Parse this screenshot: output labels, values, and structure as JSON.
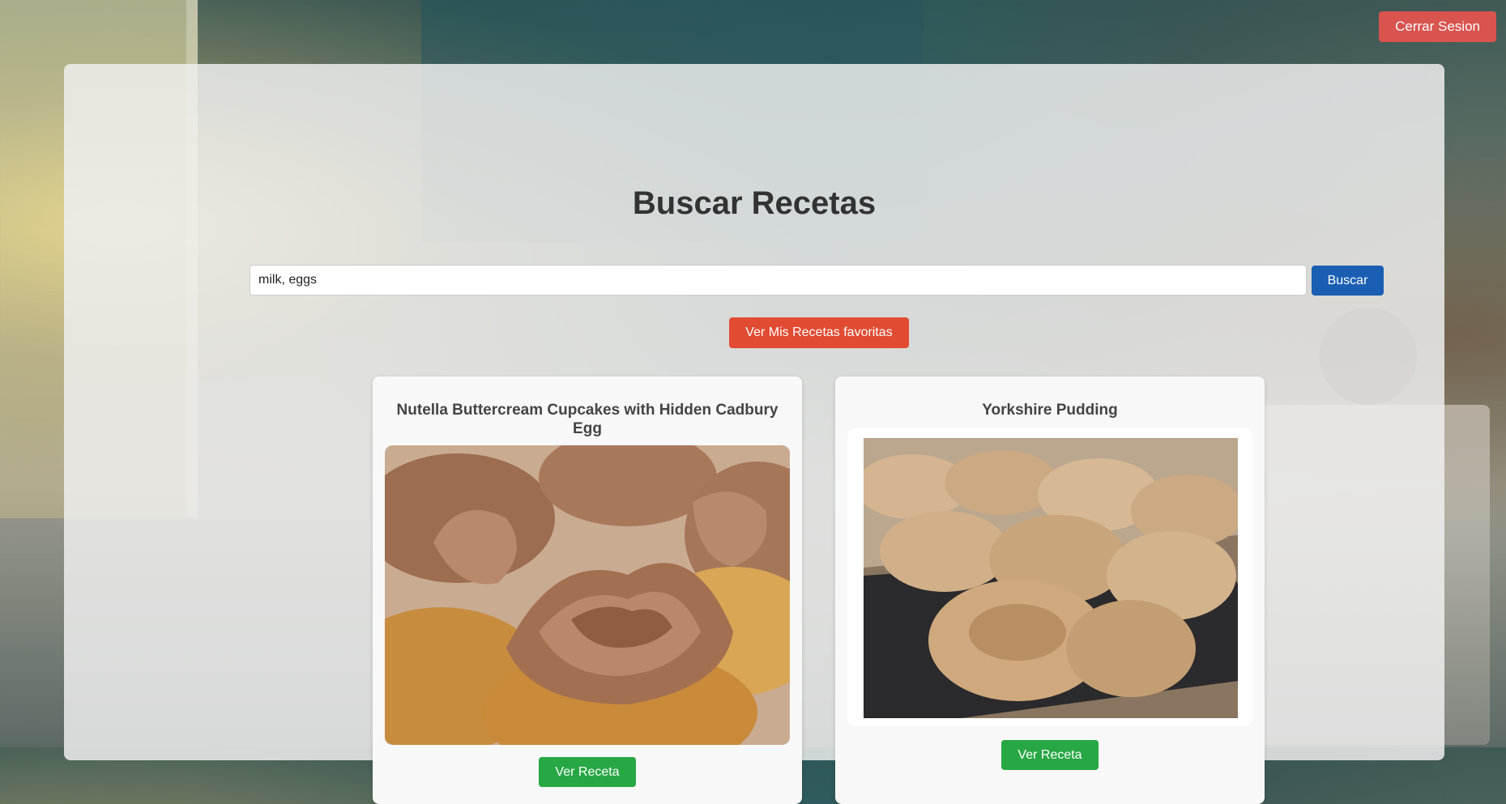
{
  "header": {
    "logout_label": "Cerrar Sesion"
  },
  "main": {
    "title": "Buscar Recetas",
    "search": {
      "value": "milk, eggs",
      "button_label": "Buscar"
    },
    "favorites_label": "Ver Mis Recetas favoritas"
  },
  "recipes": [
    {
      "title": "Nutella Buttercream Cupcakes with Hidden Cadbury Egg",
      "image": "cupcakes-photo",
      "button_label": "Ver Receta"
    },
    {
      "title": "Yorkshire Pudding",
      "image": "yorkshire-pudding-photo",
      "button_label": "Ver Receta"
    }
  ],
  "colors": {
    "logout": "#d9534f",
    "search_button": "#1a5fb4",
    "favorites_button": "#e14b32",
    "view_button": "#28a745"
  }
}
